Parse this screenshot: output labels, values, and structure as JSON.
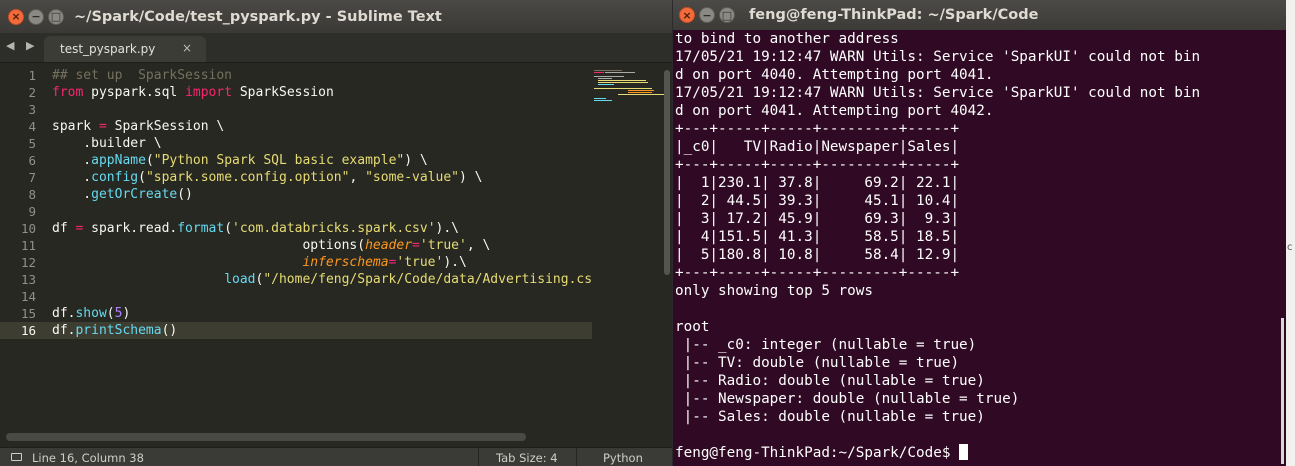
{
  "sublime": {
    "title": "~/Spark/Code/test_pyspark.py - Sublime Text",
    "nav_arrows": "◀ ▶",
    "tab": {
      "label": "test_pyspark.py",
      "close": "×"
    },
    "line_numbers": [
      "1",
      "2",
      "3",
      "4",
      "5",
      "6",
      "7",
      "8",
      "9",
      "10",
      "11",
      "12",
      "13",
      "14",
      "15",
      "16"
    ],
    "code": {
      "l1_comment": "## set up  SparkSession",
      "l2_from": "from",
      "l2_module": " pyspark.sql ",
      "l2_import": "import",
      "l2_name": " SparkSession",
      "l4_a": "spark ",
      "l4_eq": "=",
      "l4_b": " SparkSession \\",
      "l5": "    .builder \\",
      "l6_a": "    .",
      "l6_fn": "appName",
      "l6_b": "(",
      "l6_str": "\"Python Spark SQL basic example\"",
      "l6_c": ") \\",
      "l7_a": "    .",
      "l7_fn": "config",
      "l7_b": "(",
      "l7_str1": "\"spark.some.config.option\"",
      "l7_c": ", ",
      "l7_str2": "\"some-value\"",
      "l7_d": ") \\",
      "l8_a": "    .",
      "l8_fn": "getOrCreate",
      "l8_b": "()",
      "l10_a": "df ",
      "l10_eq": "=",
      "l10_b": " spark.read.",
      "l10_fn": "format",
      "l10_c": "(",
      "l10_str": "'com.databricks.spark.csv'",
      "l10_d": ").\\",
      "l11_indent": "                                ",
      "l11_a": "options(",
      "l11_param": "header",
      "l11_eq": "=",
      "l11_str": "'true'",
      "l11_b": ", \\",
      "l12_indent": "                                ",
      "l12_param": "inferschema",
      "l12_eq": "=",
      "l12_str": "'true'",
      "l12_b": ").\\",
      "l13_indent": "                      ",
      "l13_fn": "load",
      "l13_a": "(",
      "l13_str": "\"/home/feng/Spark/Code/data/Advertising.cs",
      "l15_a": "df.",
      "l15_fn": "show",
      "l15_b": "(",
      "l15_num": "5",
      "l15_c": ")",
      "l16_a": "df.",
      "l16_fn": "printSchema",
      "l16_b": "()"
    },
    "status": {
      "position": "Line 16, Column 38",
      "tab_size": "Tab Size: 4",
      "syntax": "Python"
    },
    "colors": {
      "background": "#272822",
      "comment": "#75715e",
      "keyword": "#f92672",
      "string": "#e6db74",
      "function": "#66d9ef",
      "parameter": "#fd971f",
      "number": "#ae81ff"
    }
  },
  "terminal": {
    "title": "feng@feng-ThinkPad: ~/Spark/Code",
    "lines": [
      "to bind to another address",
      "17/05/21 19:12:47 WARN Utils: Service 'SparkUI' could not bin",
      "d on port 4040. Attempting port 4041.",
      "17/05/21 19:12:47 WARN Utils: Service 'SparkUI' could not bin",
      "d on port 4041. Attempting port 4042.",
      "+---+-----+-----+---------+-----+",
      "|_c0|   TV|Radio|Newspaper|Sales|",
      "+---+-----+-----+---------+-----+",
      "|  1|230.1| 37.8|     69.2| 22.1|",
      "|  2| 44.5| 39.3|     45.1| 10.4|",
      "|  3| 17.2| 45.9|     69.3|  9.3|",
      "|  4|151.5| 41.3|     58.5| 18.5|",
      "|  5|180.8| 10.8|     58.4| 12.9|",
      "+---+-----+-----+---------+-----+",
      "only showing top 5 rows",
      "",
      "root",
      " |-- _c0: integer (nullable = true)",
      " |-- TV: double (nullable = true)",
      " |-- Radio: double (nullable = true)",
      " |-- Newspaper: double (nullable = true)",
      " |-- Sales: double (nullable = true)",
      ""
    ],
    "prompt": "feng@feng-ThinkPad:~/Spark/Code$ ",
    "colors": {
      "background": "#300a24",
      "text": "#ffffff"
    }
  },
  "side_char": "c"
}
